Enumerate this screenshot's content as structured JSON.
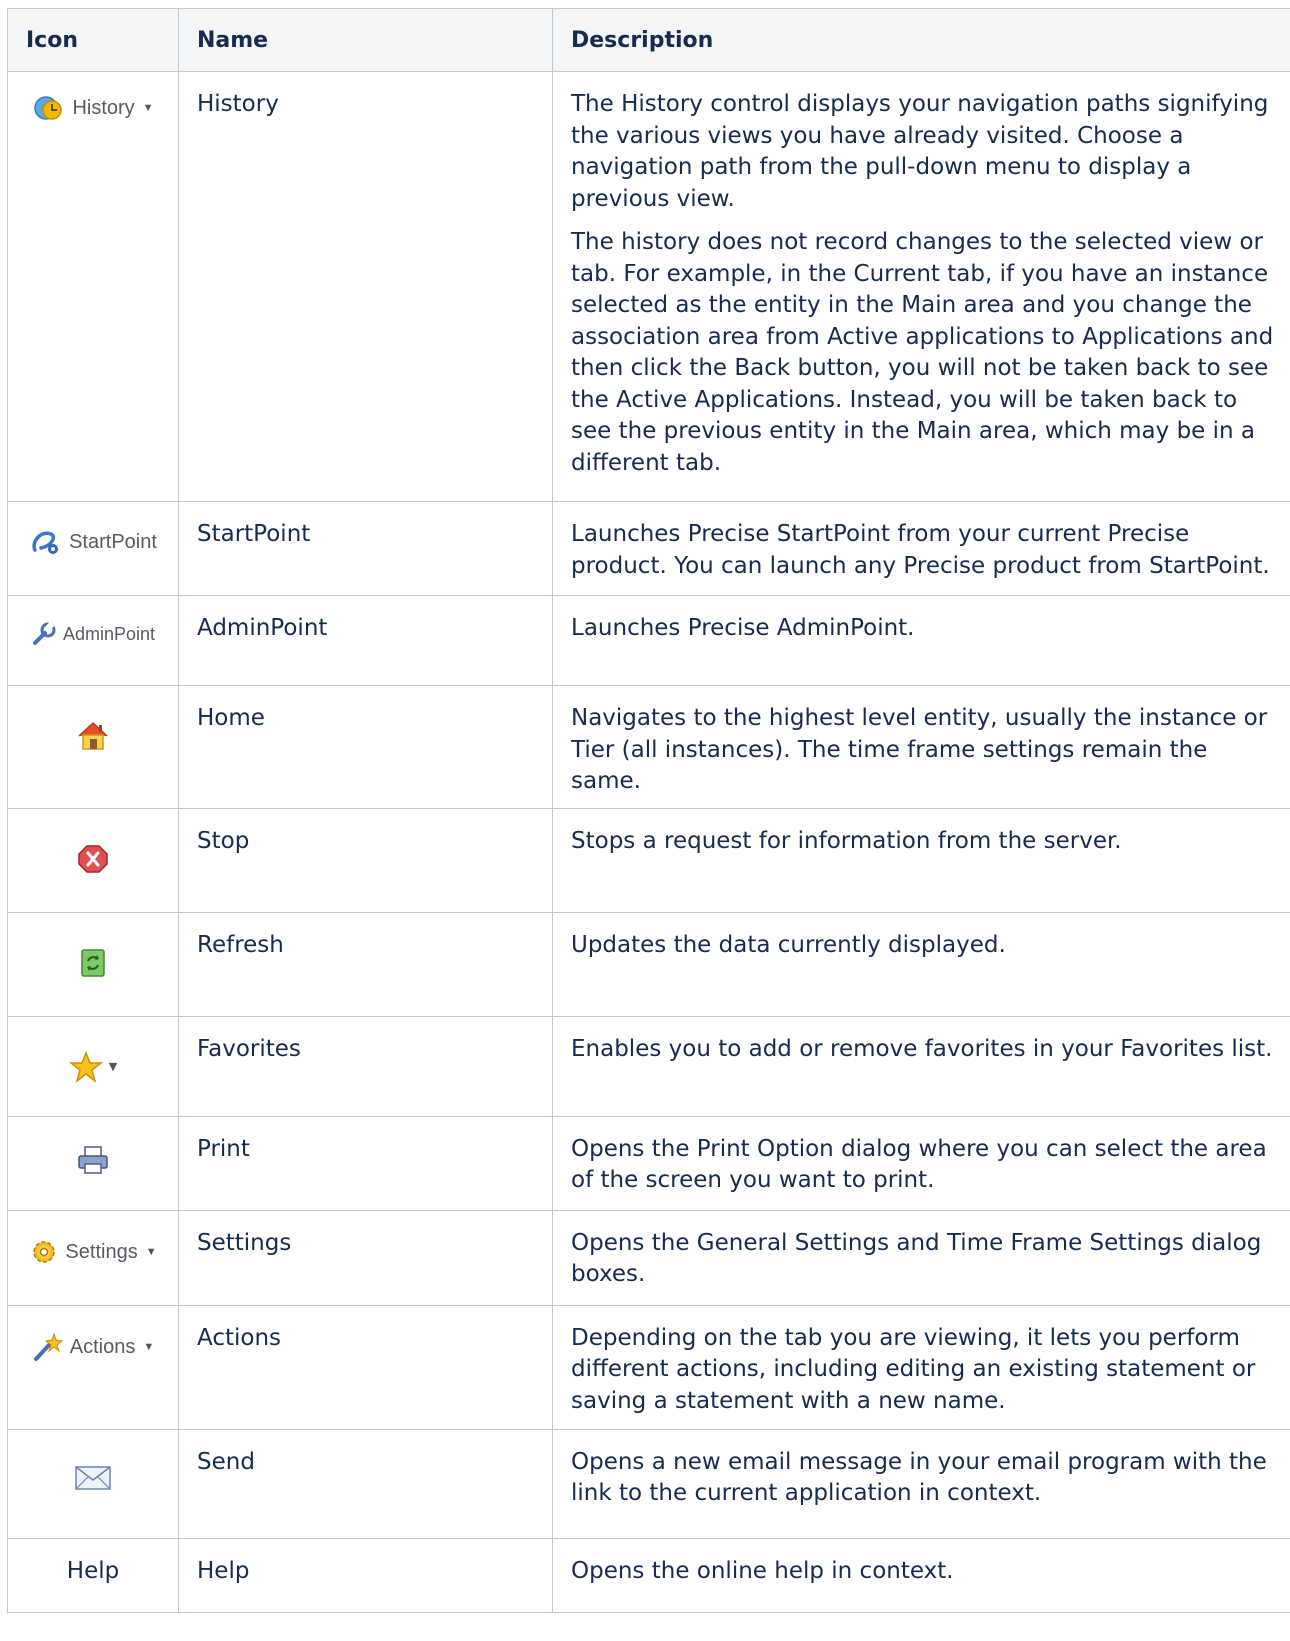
{
  "header": {
    "icon": "Icon",
    "name": "Name",
    "description": "Description"
  },
  "rows": [
    {
      "icon": {
        "name": "history-icon",
        "label": "History",
        "dropdown": true
      },
      "name": "History",
      "description": [
        "The History control displays your navigation paths signifying the various views you have already visited. Choose a navigation path from the pull-down menu to display a previous view.",
        "The history does not record changes to the selected view or tab. For example, in the Current tab, if you have an instance selected as the entity in the Main area and you change the association area from Active applications to Applications and then click the Back button, you will not be taken back to see the Active Applications. Instead, you will be taken back to see the previous entity in the Main area, which may be in a different tab."
      ]
    },
    {
      "icon": {
        "name": "startpoint-icon",
        "label": "StartPoint"
      },
      "name": "StartPoint",
      "description": [
        "Launches Precise StartPoint from your current Precise product. You can launch any Precise product from StartPoint."
      ]
    },
    {
      "icon": {
        "name": "wrench-icon",
        "label": "AdminPoint"
      },
      "name": "AdminPoint",
      "description": [
        "Launches Precise AdminPoint."
      ]
    },
    {
      "icon": {
        "name": "home-icon"
      },
      "name": "Home",
      "description": [
        "Navigates to the highest level entity, usually the instance or Tier (all instances). The time frame settings remain the same."
      ]
    },
    {
      "icon": {
        "name": "stop-icon"
      },
      "name": "Stop",
      "description": [
        "Stops a request for information from the server."
      ]
    },
    {
      "icon": {
        "name": "refresh-icon"
      },
      "name": "Refresh",
      "description": [
        "Updates the data currently displayed."
      ]
    },
    {
      "icon": {
        "name": "star-icon",
        "dropdown": true
      },
      "name": "Favorites",
      "description": [
        "Enables you to add or remove favorites in your Favorites list."
      ]
    },
    {
      "icon": {
        "name": "printer-icon"
      },
      "name": "Print",
      "description": [
        "Opens the Print Option dialog where you can select the area of the screen you want to print."
      ]
    },
    {
      "icon": {
        "name": "gear-icon",
        "label": "Settings",
        "dropdown": true
      },
      "name": "Settings",
      "description": [
        "Opens the General Settings and Time Frame Settings dialog boxes."
      ]
    },
    {
      "icon": {
        "name": "magic-wand-icon",
        "label": "Actions",
        "dropdown": true
      },
      "name": "Actions",
      "description": [
        "Depending on the tab you are viewing, it lets you perform different actions, including editing an existing statement or saving a statement with a new name."
      ]
    },
    {
      "icon": {
        "name": "envelope-icon"
      },
      "name": "Send",
      "description": [
        "Opens a new email message in your email program with the link to the current application in context."
      ]
    },
    {
      "icon": {
        "name": "help-text",
        "label": "Help"
      },
      "name": "Help",
      "description": [
        "Opens the online help in context."
      ]
    }
  ]
}
